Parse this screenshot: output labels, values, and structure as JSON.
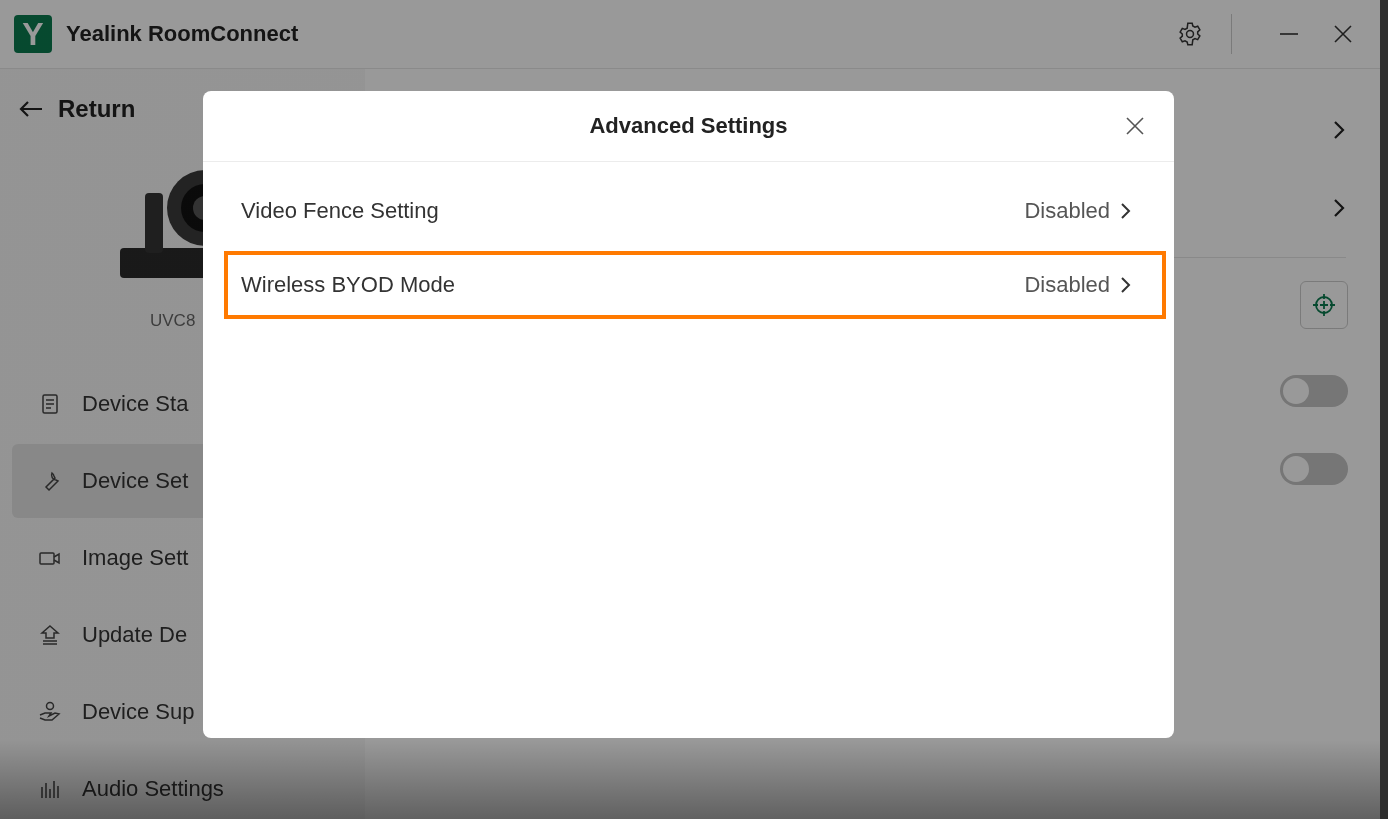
{
  "window": {
    "title": "Yealink RoomConnect",
    "logo": "Y"
  },
  "sidebar": {
    "back": "Return",
    "device_name": "UVC8",
    "items": [
      {
        "label": "Device Sta",
        "selected": false
      },
      {
        "label": "Device Set",
        "selected": true
      },
      {
        "label": "Image Sett",
        "selected": false
      },
      {
        "label": "Update De",
        "selected": false
      },
      {
        "label": "Device Sup",
        "selected": false
      },
      {
        "label": "Audio Settings",
        "selected": false
      }
    ]
  },
  "main": {
    "rows": [
      {
        "kind": "link"
      },
      {
        "kind": "link"
      },
      {
        "kind": "locate"
      },
      {
        "kind": "toggle",
        "on": false
      },
      {
        "kind": "toggle",
        "on": false
      }
    ]
  },
  "dialog": {
    "title": "Advanced Settings",
    "items": [
      {
        "label": "Video Fence Setting",
        "value": "Disabled",
        "highlighted": false
      },
      {
        "label": "Wireless BYOD Mode",
        "value": "Disabled",
        "highlighted": true
      }
    ]
  }
}
